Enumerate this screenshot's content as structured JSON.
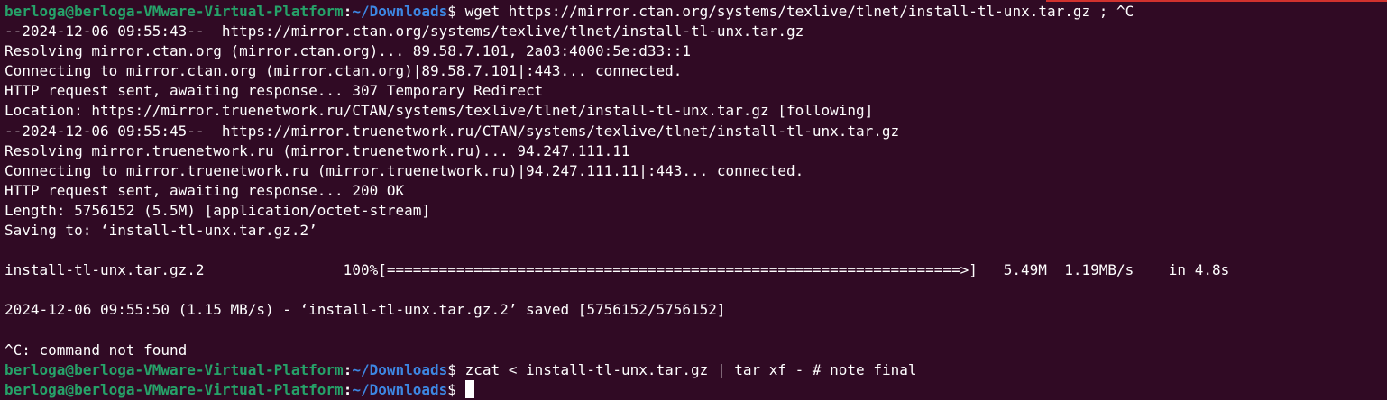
{
  "colors": {
    "background": "#300a24",
    "text": "#ffffff",
    "prompt_user": "#26a269",
    "prompt_path": "#3d87e3",
    "accent": "#d1322e"
  },
  "prompt": {
    "user_host": "berloga@berloga-VMware-Virtual-Platform",
    "separator": ":",
    "path": "~/Downloads",
    "symbol": "$"
  },
  "commands": {
    "first": " wget https://mirror.ctan.org/systems/texlive/tlnet/install-tl-unx.tar.gz ; ^C",
    "second": " zcat < install-tl-unx.tar.gz | tar xf - # note final",
    "third": " "
  },
  "output": {
    "l1": "--2024-12-06 09:55:43--  https://mirror.ctan.org/systems/texlive/tlnet/install-tl-unx.tar.gz",
    "l2": "Resolving mirror.ctan.org (mirror.ctan.org)... 89.58.7.101, 2a03:4000:5e:d33::1",
    "l3": "Connecting to mirror.ctan.org (mirror.ctan.org)|89.58.7.101|:443... connected.",
    "l4": "HTTP request sent, awaiting response... 307 Temporary Redirect",
    "l5": "Location: https://mirror.truenetwork.ru/CTAN/systems/texlive/tlnet/install-tl-unx.tar.gz [following]",
    "l6": "--2024-12-06 09:55:45--  https://mirror.truenetwork.ru/CTAN/systems/texlive/tlnet/install-tl-unx.tar.gz",
    "l7": "Resolving mirror.truenetwork.ru (mirror.truenetwork.ru)... 94.247.111.11",
    "l8": "Connecting to mirror.truenetwork.ru (mirror.truenetwork.ru)|94.247.111.11|:443... connected.",
    "l9": "HTTP request sent, awaiting response... 200 OK",
    "l10": "Length: 5756152 (5.5M) [application/octet-stream]",
    "l11": "Saving to: ‘install-tl-unx.tar.gz.2’",
    "progress": "install-tl-unx.tar.gz.2                100%[==================================================================>]   5.49M  1.19MB/s    in 4.8s",
    "saved": "2024-12-06 09:55:50 (1.15 MB/s) - ‘install-tl-unx.tar.gz.2’ saved [5756152/5756152]",
    "not_found": "^C: command not found"
  }
}
